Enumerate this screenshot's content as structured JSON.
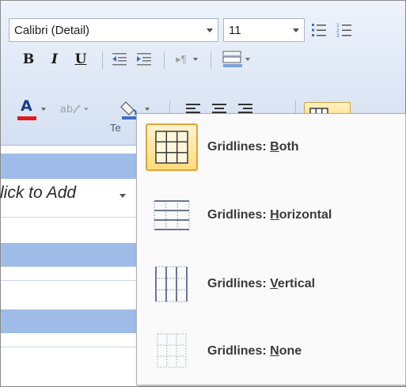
{
  "ribbon": {
    "font_name": "Calibri (Detail)",
    "font_size": "11",
    "bold_glyph": "B",
    "italic_glyph": "I",
    "underline_glyph": "U",
    "font_color_glyph": "A",
    "highlight_glyph": "ab",
    "group_label": "Te",
    "accent_red": "#e11a1a",
    "accent_selected": "#ffd662"
  },
  "sheet": {
    "column_header": "lick to Add"
  },
  "gridlines_menu": {
    "items": [
      {
        "prefix": "Gridlines: ",
        "key": "B",
        "rest": "oth",
        "selected": true,
        "icon": "gridlines-both-icon"
      },
      {
        "prefix": "Gridlines: ",
        "key": "H",
        "rest": "orizontal",
        "selected": false,
        "icon": "gridlines-horizontal-icon"
      },
      {
        "prefix": "Gridlines: ",
        "key": "V",
        "rest": "ertical",
        "selected": false,
        "icon": "gridlines-vertical-icon"
      },
      {
        "prefix": "Gridlines: ",
        "key": "N",
        "rest": "one",
        "selected": false,
        "icon": "gridlines-none-icon"
      }
    ]
  }
}
